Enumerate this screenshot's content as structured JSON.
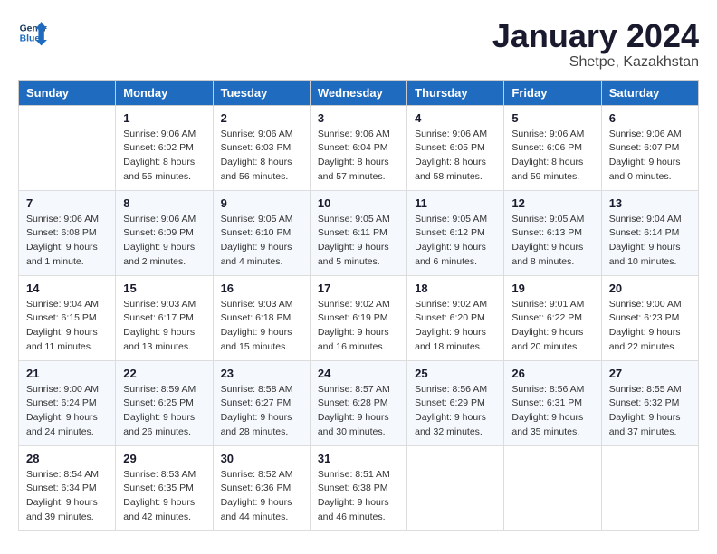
{
  "logo": {
    "line1": "General",
    "line2": "Blue"
  },
  "title": "January 2024",
  "subtitle": "Shetpe, Kazakhstan",
  "days_of_week": [
    "Sunday",
    "Monday",
    "Tuesday",
    "Wednesday",
    "Thursday",
    "Friday",
    "Saturday"
  ],
  "weeks": [
    [
      {
        "day": "",
        "sunrise": "",
        "sunset": "",
        "daylight": ""
      },
      {
        "day": "1",
        "sunrise": "Sunrise: 9:06 AM",
        "sunset": "Sunset: 6:02 PM",
        "daylight": "Daylight: 8 hours and 55 minutes."
      },
      {
        "day": "2",
        "sunrise": "Sunrise: 9:06 AM",
        "sunset": "Sunset: 6:03 PM",
        "daylight": "Daylight: 8 hours and 56 minutes."
      },
      {
        "day": "3",
        "sunrise": "Sunrise: 9:06 AM",
        "sunset": "Sunset: 6:04 PM",
        "daylight": "Daylight: 8 hours and 57 minutes."
      },
      {
        "day": "4",
        "sunrise": "Sunrise: 9:06 AM",
        "sunset": "Sunset: 6:05 PM",
        "daylight": "Daylight: 8 hours and 58 minutes."
      },
      {
        "day": "5",
        "sunrise": "Sunrise: 9:06 AM",
        "sunset": "Sunset: 6:06 PM",
        "daylight": "Daylight: 8 hours and 59 minutes."
      },
      {
        "day": "6",
        "sunrise": "Sunrise: 9:06 AM",
        "sunset": "Sunset: 6:07 PM",
        "daylight": "Daylight: 9 hours and 0 minutes."
      }
    ],
    [
      {
        "day": "7",
        "sunrise": "Sunrise: 9:06 AM",
        "sunset": "Sunset: 6:08 PM",
        "daylight": "Daylight: 9 hours and 1 minute."
      },
      {
        "day": "8",
        "sunrise": "Sunrise: 9:06 AM",
        "sunset": "Sunset: 6:09 PM",
        "daylight": "Daylight: 9 hours and 2 minutes."
      },
      {
        "day": "9",
        "sunrise": "Sunrise: 9:05 AM",
        "sunset": "Sunset: 6:10 PM",
        "daylight": "Daylight: 9 hours and 4 minutes."
      },
      {
        "day": "10",
        "sunrise": "Sunrise: 9:05 AM",
        "sunset": "Sunset: 6:11 PM",
        "daylight": "Daylight: 9 hours and 5 minutes."
      },
      {
        "day": "11",
        "sunrise": "Sunrise: 9:05 AM",
        "sunset": "Sunset: 6:12 PM",
        "daylight": "Daylight: 9 hours and 6 minutes."
      },
      {
        "day": "12",
        "sunrise": "Sunrise: 9:05 AM",
        "sunset": "Sunset: 6:13 PM",
        "daylight": "Daylight: 9 hours and 8 minutes."
      },
      {
        "day": "13",
        "sunrise": "Sunrise: 9:04 AM",
        "sunset": "Sunset: 6:14 PM",
        "daylight": "Daylight: 9 hours and 10 minutes."
      }
    ],
    [
      {
        "day": "14",
        "sunrise": "Sunrise: 9:04 AM",
        "sunset": "Sunset: 6:15 PM",
        "daylight": "Daylight: 9 hours and 11 minutes."
      },
      {
        "day": "15",
        "sunrise": "Sunrise: 9:03 AM",
        "sunset": "Sunset: 6:17 PM",
        "daylight": "Daylight: 9 hours and 13 minutes."
      },
      {
        "day": "16",
        "sunrise": "Sunrise: 9:03 AM",
        "sunset": "Sunset: 6:18 PM",
        "daylight": "Daylight: 9 hours and 15 minutes."
      },
      {
        "day": "17",
        "sunrise": "Sunrise: 9:02 AM",
        "sunset": "Sunset: 6:19 PM",
        "daylight": "Daylight: 9 hours and 16 minutes."
      },
      {
        "day": "18",
        "sunrise": "Sunrise: 9:02 AM",
        "sunset": "Sunset: 6:20 PM",
        "daylight": "Daylight: 9 hours and 18 minutes."
      },
      {
        "day": "19",
        "sunrise": "Sunrise: 9:01 AM",
        "sunset": "Sunset: 6:22 PM",
        "daylight": "Daylight: 9 hours and 20 minutes."
      },
      {
        "day": "20",
        "sunrise": "Sunrise: 9:00 AM",
        "sunset": "Sunset: 6:23 PM",
        "daylight": "Daylight: 9 hours and 22 minutes."
      }
    ],
    [
      {
        "day": "21",
        "sunrise": "Sunrise: 9:00 AM",
        "sunset": "Sunset: 6:24 PM",
        "daylight": "Daylight: 9 hours and 24 minutes."
      },
      {
        "day": "22",
        "sunrise": "Sunrise: 8:59 AM",
        "sunset": "Sunset: 6:25 PM",
        "daylight": "Daylight: 9 hours and 26 minutes."
      },
      {
        "day": "23",
        "sunrise": "Sunrise: 8:58 AM",
        "sunset": "Sunset: 6:27 PM",
        "daylight": "Daylight: 9 hours and 28 minutes."
      },
      {
        "day": "24",
        "sunrise": "Sunrise: 8:57 AM",
        "sunset": "Sunset: 6:28 PM",
        "daylight": "Daylight: 9 hours and 30 minutes."
      },
      {
        "day": "25",
        "sunrise": "Sunrise: 8:56 AM",
        "sunset": "Sunset: 6:29 PM",
        "daylight": "Daylight: 9 hours and 32 minutes."
      },
      {
        "day": "26",
        "sunrise": "Sunrise: 8:56 AM",
        "sunset": "Sunset: 6:31 PM",
        "daylight": "Daylight: 9 hours and 35 minutes."
      },
      {
        "day": "27",
        "sunrise": "Sunrise: 8:55 AM",
        "sunset": "Sunset: 6:32 PM",
        "daylight": "Daylight: 9 hours and 37 minutes."
      }
    ],
    [
      {
        "day": "28",
        "sunrise": "Sunrise: 8:54 AM",
        "sunset": "Sunset: 6:34 PM",
        "daylight": "Daylight: 9 hours and 39 minutes."
      },
      {
        "day": "29",
        "sunrise": "Sunrise: 8:53 AM",
        "sunset": "Sunset: 6:35 PM",
        "daylight": "Daylight: 9 hours and 42 minutes."
      },
      {
        "day": "30",
        "sunrise": "Sunrise: 8:52 AM",
        "sunset": "Sunset: 6:36 PM",
        "daylight": "Daylight: 9 hours and 44 minutes."
      },
      {
        "day": "31",
        "sunrise": "Sunrise: 8:51 AM",
        "sunset": "Sunset: 6:38 PM",
        "daylight": "Daylight: 9 hours and 46 minutes."
      },
      {
        "day": "",
        "sunrise": "",
        "sunset": "",
        "daylight": ""
      },
      {
        "day": "",
        "sunrise": "",
        "sunset": "",
        "daylight": ""
      },
      {
        "day": "",
        "sunrise": "",
        "sunset": "",
        "daylight": ""
      }
    ]
  ]
}
